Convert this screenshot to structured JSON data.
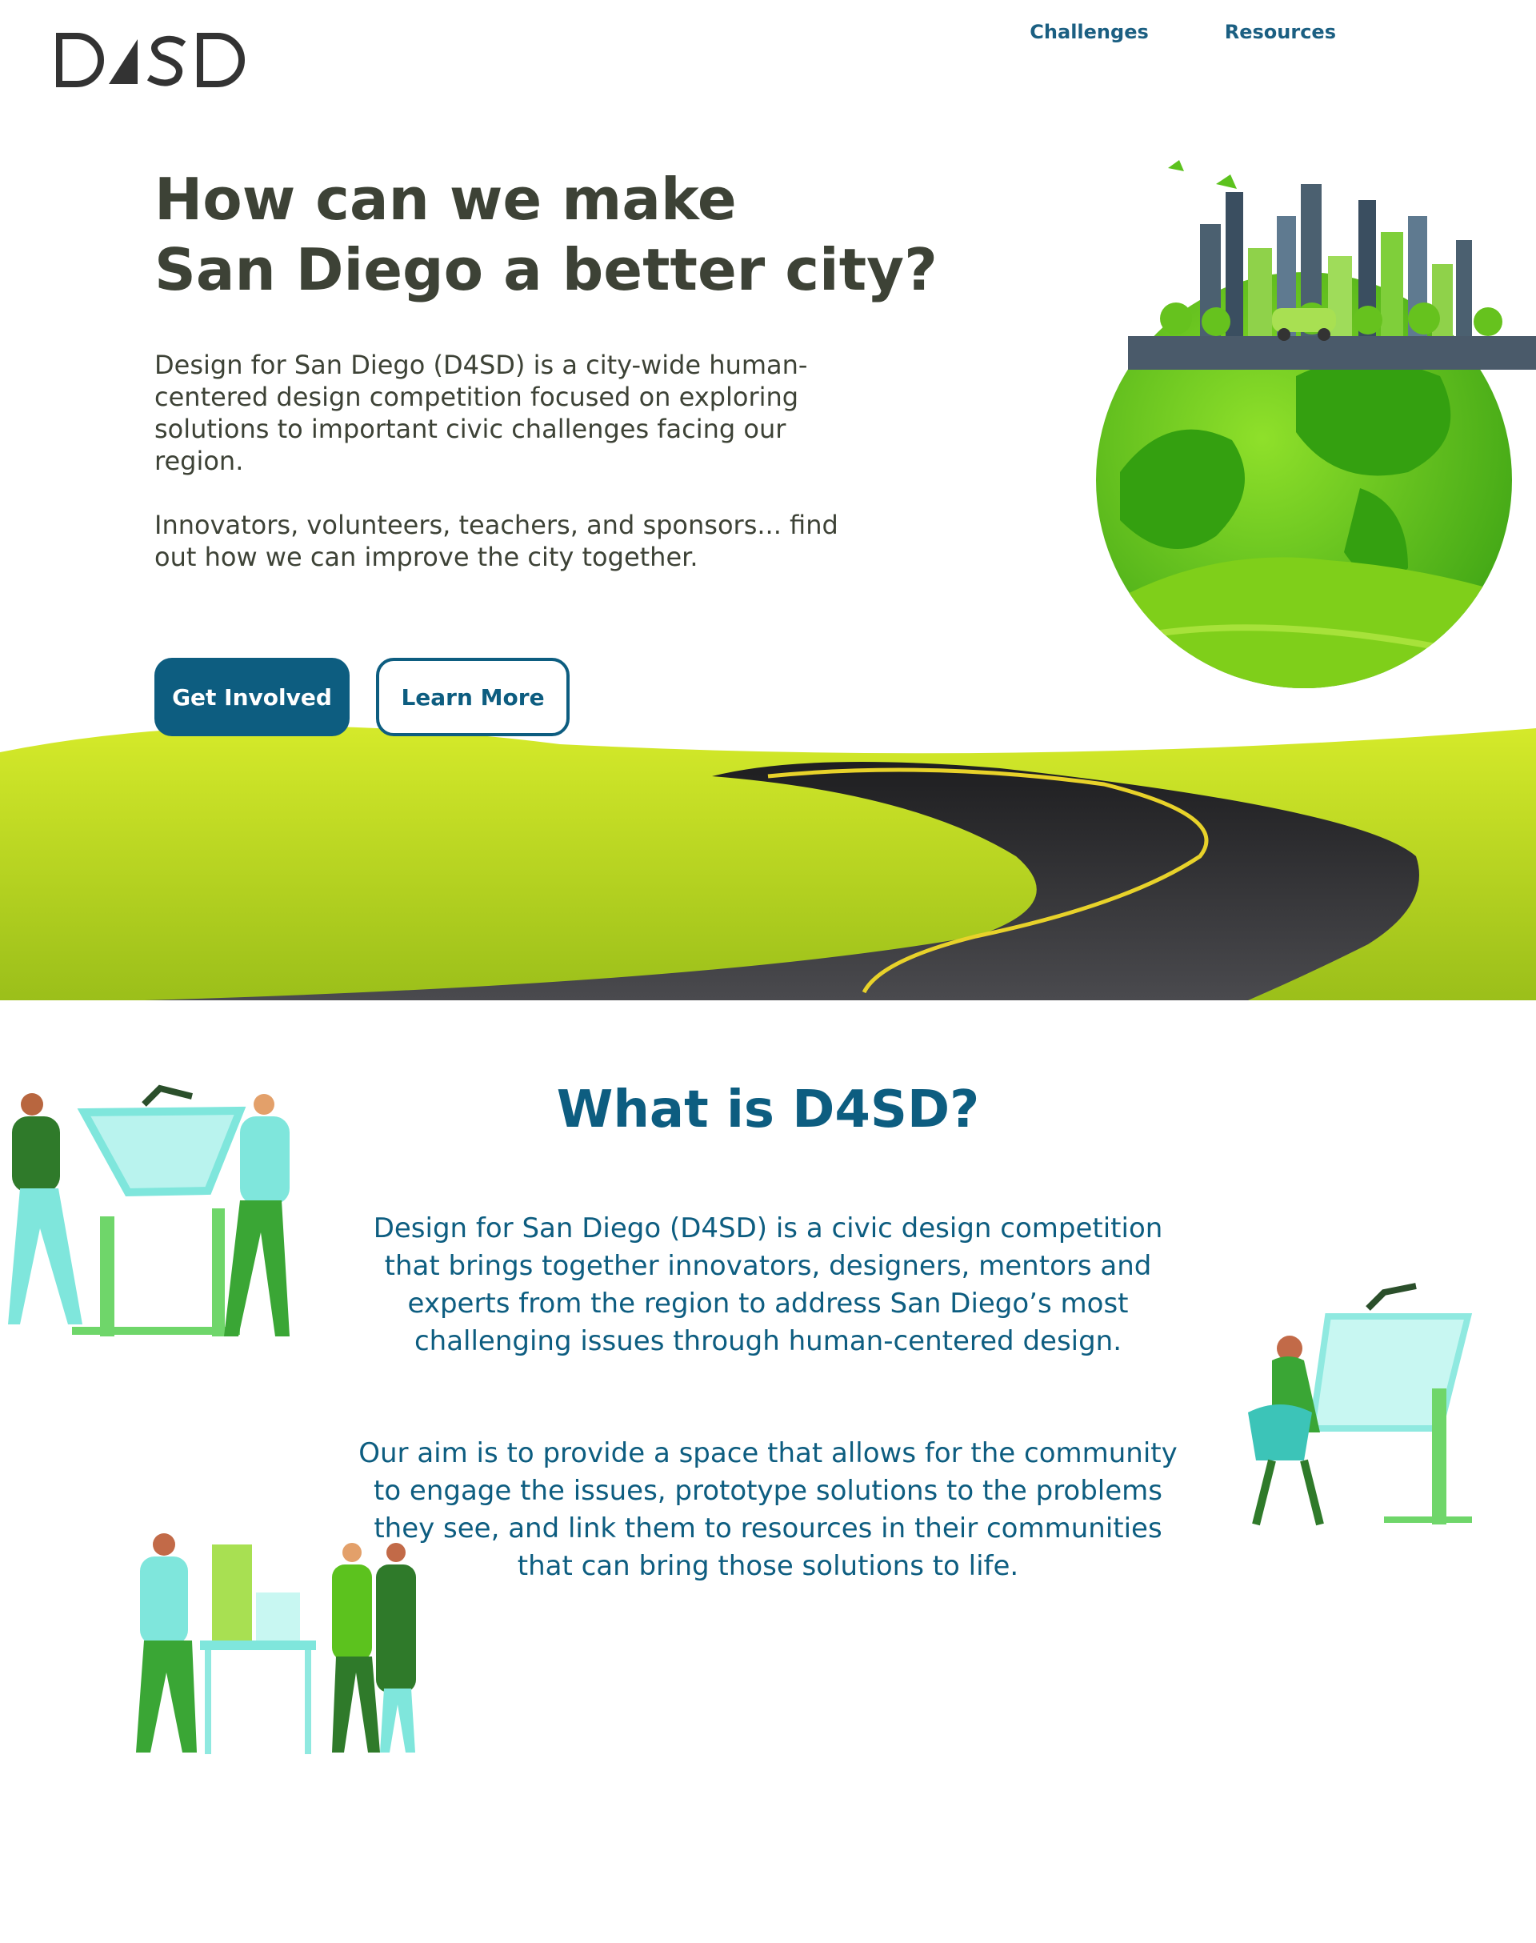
{
  "header": {
    "logo_text": "D4SD",
    "nav": [
      {
        "label": "Challenges"
      },
      {
        "label": "Resources"
      }
    ]
  },
  "hero": {
    "title_line1": "How can we make",
    "title_line2": "San Diego a better city?",
    "paragraph1": "Design for San Diego (D4SD) is a city-wide human-centered design competition focused on exploring solutions to important civic challenges facing our region.",
    "paragraph2": "Innovators, volunteers, teachers, and sponsors... find out how we can improve the city together.",
    "primary_button": "Get Involved",
    "secondary_button": "Learn More"
  },
  "about": {
    "title": "What is D4SD?",
    "paragraph1": "Design for San Diego (D4SD) is a civic design competition that brings together innovators, designers, mentors and experts from the region to address San Diego’s most challenging issues through human-centered design.",
    "paragraph2": "Our aim is to provide a space that allows for the community to engage the issues, prototype solutions to the problems they see, and link them to resources in their communities that can bring those solutions to life."
  },
  "colors": {
    "brand_blue": "#0d5d80",
    "heading_dark": "#3d4236",
    "grass": "#b5d31f",
    "road": "#2d2d30",
    "globe_green": "#62c61a"
  },
  "icons": [
    "d4sd-logo",
    "city-globe-illustration",
    "road-landscape-illustration",
    "designers-drafting-illustration",
    "woman-drafting-illustration",
    "architects-model-illustration"
  ]
}
